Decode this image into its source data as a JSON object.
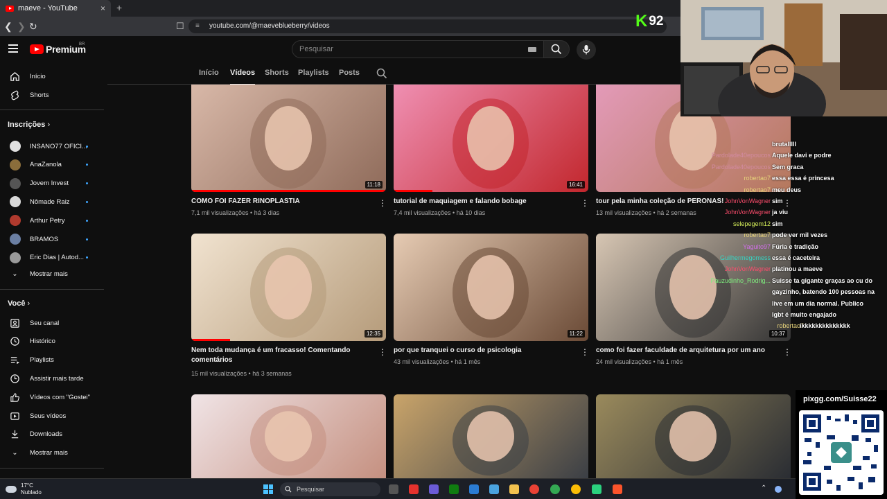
{
  "browser": {
    "tab_title": "maeve - YouTube",
    "tab_close": "×",
    "new_tab": "+",
    "url": "youtube.com/@maeveblueberry/videos"
  },
  "masthead": {
    "logo_text": "Premium",
    "logo_country": "BR",
    "search_placeholder": "Pesquisar"
  },
  "sidebar": {
    "main": [
      {
        "label": "Início",
        "icon": "home-icon"
      },
      {
        "label": "Shorts",
        "icon": "shorts-icon"
      }
    ],
    "subs_header": "Inscrições",
    "subs": [
      {
        "label": "INSANO77 OFICI...",
        "color": "#e0e0e0"
      },
      {
        "label": "AnaZanola",
        "color": "#8a6d3b"
      },
      {
        "label": "Jovem Invest",
        "color": "#555555"
      },
      {
        "label": "Nômade Raiz",
        "color": "#d9d9d9"
      },
      {
        "label": "Arthur Petry",
        "color": "#b03a2e"
      },
      {
        "label": "BRAMOS",
        "color": "#6b7fa3"
      },
      {
        "label": "Eric Dias | Autod...",
        "color": "#9a9a9a"
      }
    ],
    "subs_more": "Mostrar mais",
    "you_header": "Você",
    "you": [
      {
        "label": "Seu canal",
        "icon": "channel-icon"
      },
      {
        "label": "Histórico",
        "icon": "history-icon"
      },
      {
        "label": "Playlists",
        "icon": "playlists-icon"
      },
      {
        "label": "Assistir mais tarde",
        "icon": "watch-later-icon"
      },
      {
        "label": "Vídeos com \"Gostei\"",
        "icon": "like-icon"
      },
      {
        "label": "Seus vídeos",
        "icon": "your-videos-icon"
      },
      {
        "label": "Downloads",
        "icon": "download-icon"
      }
    ],
    "you_more": "Mostrar mais"
  },
  "channel_tabs": [
    "Início",
    "Vídeos",
    "Shorts",
    "Playlists",
    "Posts"
  ],
  "active_tab": "Vídeos",
  "videos": [
    {
      "title": "COMO FOI FAZER RINOPLASTIA",
      "title2": "",
      "views": "7,1 mil visualizações",
      "age": "há 3 dias",
      "duration": "11:18",
      "progress": 1.0,
      "bg1": "#d8b8a8",
      "bg2": "#8f6b5a"
    },
    {
      "title": "tutorial de maquiagem e falando bobage",
      "title2": "",
      "views": "7,4 mil visualizações",
      "age": "há 10 dias",
      "duration": "16:41",
      "progress": 0.2,
      "bg1": "#ef8fb2",
      "bg2": "#c2272d"
    },
    {
      "title": "tour pela minha coleção de PERONAS!",
      "title2": "",
      "views": "13 mil visualizações",
      "age": "há 2 semanas",
      "duration": "",
      "progress": 0,
      "bg1": "#e39ab8",
      "bg2": "#b4785c"
    },
    {
      "title": "Nem toda mudança é um fracasso! Comentando",
      "title2": "comentários",
      "views": "15 mil visualizações",
      "age": "há 3 semanas",
      "duration": "12:35",
      "progress": 0.2,
      "bg1": "#f1e3d0",
      "bg2": "#b59b7a"
    },
    {
      "title": "por que tranquei o curso de psicologia",
      "title2": "",
      "views": "43 mil visualizações",
      "age": "há 1 mês",
      "duration": "11:22",
      "progress": 0,
      "bg1": "#e6cbb3",
      "bg2": "#6a4a36"
    },
    {
      "title": "como foi fazer faculdade de arquitetura por um ano",
      "title2": "",
      "views": "24 mil visualizações",
      "age": "há 1 mês",
      "duration": "10:37",
      "progress": 0,
      "bg1": "#d7c6b3",
      "bg2": "#333333"
    },
    {
      "title": "",
      "title2": "",
      "views": "",
      "age": "",
      "duration": "",
      "progress": 0,
      "bg1": "#f0e4e6",
      "bg2": "#c59080"
    },
    {
      "title": "",
      "title2": "",
      "views": "",
      "age": "",
      "duration": "",
      "progress": 0,
      "bg1": "#c9a46a",
      "bg2": "#3b3f45"
    },
    {
      "title": "",
      "title2": "",
      "views": "",
      "age": "",
      "duration": "",
      "progress": 0,
      "bg1": "#9a8a5c",
      "bg2": "#2a2d33"
    }
  ],
  "overlay": {
    "kick_k": "K",
    "kick_viewers": "92",
    "pix_text": "pixgg.com/Suisse22",
    "chat": [
      {
        "name": "",
        "msg": "brutalllll",
        "color": "#ffffff"
      },
      {
        "name": "Pardolade40epoucos",
        "msg": "Aquele davi e podre",
        "color": "#d28aa0"
      },
      {
        "name": "Pardolade40epoucos",
        "msg": "Sem graca",
        "color": "#d28aa0"
      },
      {
        "name": "robertao7",
        "msg": "essa essa é princesa",
        "color": "#e6d27a"
      },
      {
        "name": "robertao7",
        "msg": "meu deus",
        "color": "#e6d27a"
      },
      {
        "name": "JohnVonWagner",
        "msg": "sim",
        "color": "#ff4d6d"
      },
      {
        "name": "JohnVonWagner",
        "msg": "ja viu",
        "color": "#ff4d6d"
      },
      {
        "name": "selepegem12",
        "msg": "sim",
        "color": "#d7f05a"
      },
      {
        "name": "robertao7",
        "msg": "pode ver mil vezes",
        "color": "#e6d27a"
      },
      {
        "name": "Yaguito97",
        "msg": "Fúria e tradição",
        "color": "#d070e8"
      },
      {
        "name": "Guilhermegomess",
        "msg": "essa é caceteira",
        "color": "#35d6c4"
      },
      {
        "name": "JohnVonWagner",
        "msg": "platinou a maeve",
        "color": "#ff4d6d"
      },
      {
        "name": "Pauzudinho_Rodrig...",
        "msg": "Suisse ta gigante graças ao cu do",
        "color": "#7ef07e"
      },
      {
        "name": "",
        "msg": "gayzinho, batendo 100 pessoas na",
        "color": "#ffffff"
      },
      {
        "name": "",
        "msg": "live em um dia normal. Publico",
        "color": "#ffffff"
      },
      {
        "name": "",
        "msg": "lgbt é muito engajado",
        "color": "#ffffff"
      },
      {
        "name": "robertao7",
        "msg": "ikkkkkkkkkkkkkk",
        "color": "#e6d27a"
      }
    ]
  },
  "taskbar": {
    "temp": "17°C",
    "condition": "Nublado",
    "search_placeholder": "Pesquisar"
  }
}
